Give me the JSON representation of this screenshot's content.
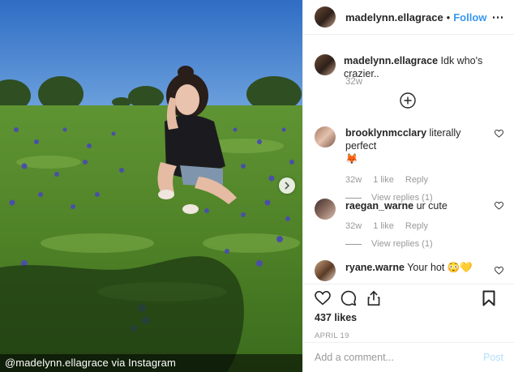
{
  "photo": {
    "credit": "@madelynn.ellagrace via Instagram",
    "next_icon": "chevron-right-icon"
  },
  "post": {
    "username": "madelynn.ellagrace",
    "dot": "•",
    "follow_label": "Follow",
    "caption_user": "madelynn.ellagrace",
    "caption_text": "Idk who's crazier..",
    "caption_time": "32w",
    "load_more_icon": "plus-circle-icon"
  },
  "comments": [
    {
      "user": "brooklynmcclary",
      "text": "literally perfect",
      "emoji": "🦊",
      "time": "32w",
      "likes": "1 like",
      "reply": "Reply",
      "view_replies": "View replies (1)"
    },
    {
      "user": "raegan_warne",
      "text": "ur cute",
      "time": "32w",
      "likes": "1 like",
      "reply": "Reply",
      "view_replies": "View replies (1)"
    },
    {
      "user": "ryane.warne",
      "text": "Your hot",
      "emoji": "😳💛"
    }
  ],
  "actions": {
    "likes": "437 likes",
    "date": "APRIL 19"
  },
  "add_comment": {
    "placeholder": "Add a comment...",
    "post_label": "Post"
  },
  "colors": {
    "link": "#3897f0",
    "muted": "#999999",
    "post_disabled": "#b2dffc"
  }
}
